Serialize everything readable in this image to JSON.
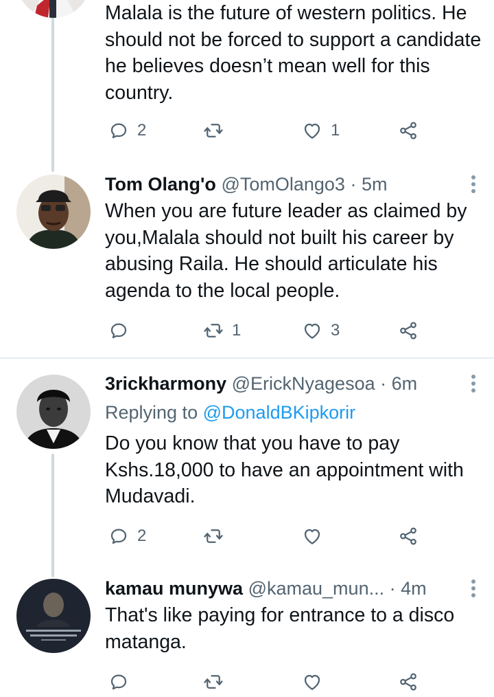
{
  "tweets": [
    {
      "text": "Malala is the future of western politics. He should not be forced to support a candidate he believes doesn’t mean well for this country.",
      "reply_count": "2",
      "retweet_count": "",
      "like_count": "1"
    },
    {
      "name": "Tom Olang'o",
      "handle": "@TomOlango3",
      "time": "· 5m",
      "text": "When you are future leader as claimed by you,Malala should not built his career by abusing Raila. He should articulate his agenda to the local people.",
      "reply_count": "",
      "retweet_count": "1",
      "like_count": "3"
    },
    {
      "name": "3rickharmony",
      "handle": "@ErickNyagesoa",
      "time": "· 6m",
      "replying_label": "Replying to",
      "replying_handle": "@DonaldBKipkorir",
      "text": "Do you know that you have to pay Kshs.18,000 to have an appointment with Mudavadi.",
      "reply_count": "2",
      "retweet_count": "",
      "like_count": ""
    },
    {
      "name": "kamau munywa",
      "handle": "@kamau_mun...",
      "time": "· 4m",
      "text": "That's like paying for entrance to a disco matanga.",
      "reply_count": "",
      "retweet_count": "",
      "like_count": ""
    }
  ],
  "colors": {
    "text": "#0f1419",
    "secondary": "#536471",
    "link": "#1d9bf0",
    "thread_line": "#cfd9de",
    "divider": "#e6ecf0"
  },
  "icons": [
    "reply-icon",
    "retweet-icon",
    "like-icon",
    "share-icon",
    "more-icon"
  ]
}
